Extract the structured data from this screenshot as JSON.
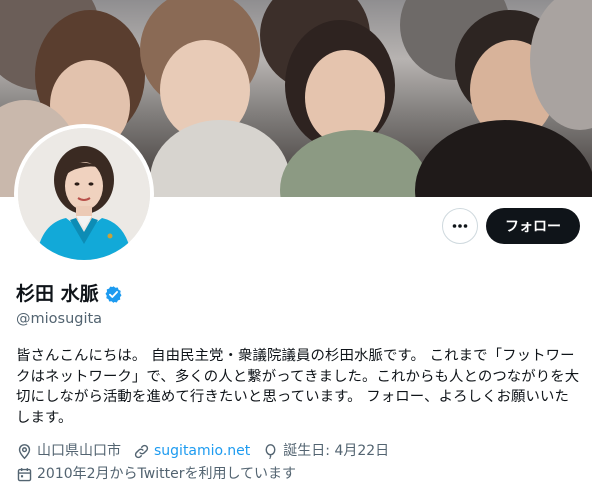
{
  "profile": {
    "display_name": "杉田 水脈",
    "handle": "@miosugita",
    "verified_icon": "verified-badge-icon",
    "bio": "皆さんこんにちは。 自由民主党・衆議院議員の杉田水脈です。 これまで「フットワークはネットワーク」で、多くの人と繋がってきました。これからも人とのつながりを大切にしながら活動を進めて行きたいと思っています。 フォロー、よろしくお願いいたします。",
    "location": "山口県山口市",
    "website": "sugitamio.net",
    "birthday": "誕生日: 4月22日",
    "joined": "2010年2月からTwitterを利用しています"
  },
  "actions": {
    "more_icon": "more-options-icon",
    "follow_label": "フォロー"
  },
  "colors": {
    "accent": "#1d9bf0",
    "text": "#0f1419",
    "secondary": "#536471",
    "follow_bg": "#0f1419"
  }
}
